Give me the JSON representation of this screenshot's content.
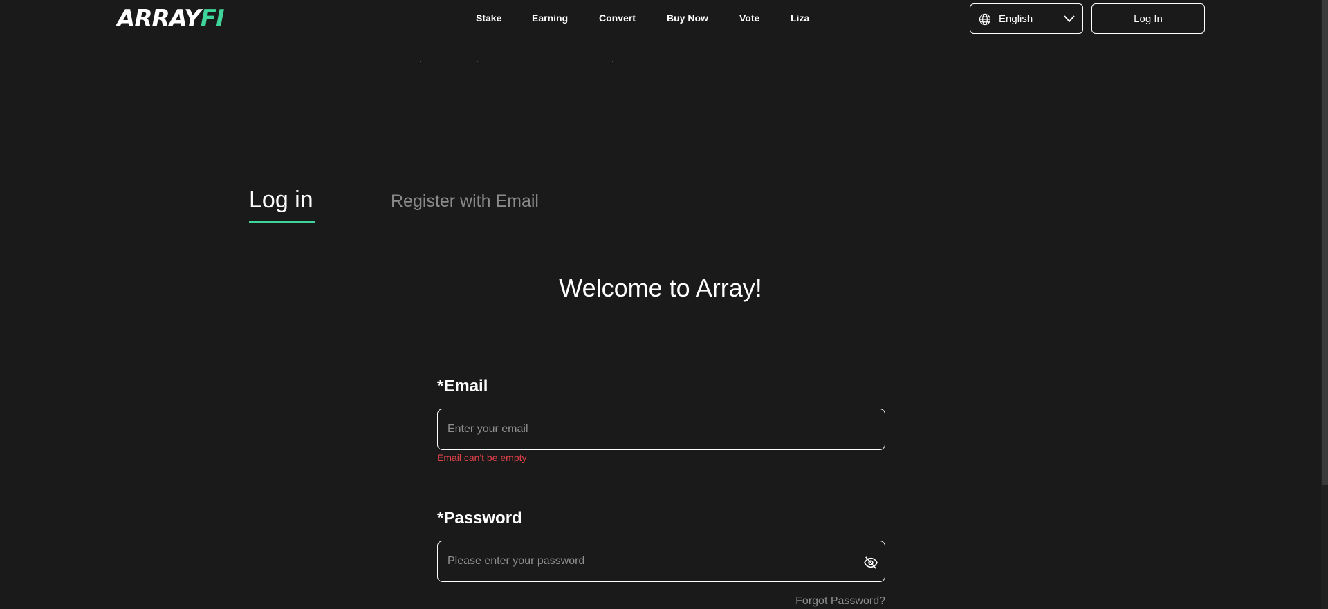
{
  "brand": {
    "logo_part1": "ARRAY",
    "logo_part2": "FI",
    "accent_color": "#3fd49a"
  },
  "nav": {
    "items": [
      "Stake",
      "Earning",
      "Convert",
      "Buy Now",
      "Vote",
      "Liza"
    ]
  },
  "header": {
    "language": {
      "icon": "globe-icon",
      "selected": "English",
      "chevron": "chevron-down-icon"
    },
    "login_button": "Log In"
  },
  "tabs": {
    "login": "Log in",
    "register": "Register with Email",
    "active": "login"
  },
  "form": {
    "welcome": "Welcome to Array!",
    "email": {
      "label": "*Email",
      "placeholder": "Enter your email",
      "value": "",
      "error": "Email can't be empty"
    },
    "password": {
      "label": "*Password",
      "placeholder": "Please enter your password",
      "value": "",
      "toggle_icon": "eye-off-icon"
    },
    "forgot_password": "Forgot Password?"
  },
  "colors": {
    "background": "#1a1a1a",
    "error": "#e0424a",
    "muted": "#8a8a8a"
  }
}
